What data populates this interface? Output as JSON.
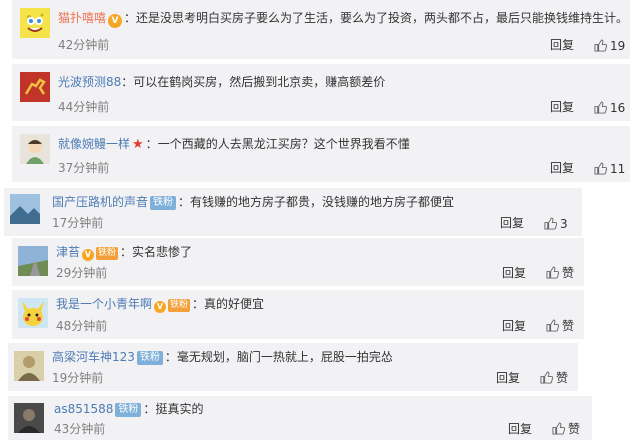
{
  "comments": [
    {
      "name": "猫扑嘻嘻",
      "name_style": "orange",
      "has_vip": true,
      "text": "还是没思考明白买房子要么为了生活，要么为了投资，两头都不占，最后只能换钱维持生计。",
      "time": "42分钟前",
      "reply": "回复",
      "likes": "19",
      "avatar_icon": "sponge-avatar-icon"
    },
    {
      "name": "光波预测88",
      "name_style": "blue",
      "text": "可以在鹤岗买房，然后搬到北京卖，赚高额差价",
      "time": "44分钟前",
      "reply": "回复",
      "likes": "16",
      "avatar_icon": "horse-avatar-icon"
    },
    {
      "name": "就像婉鳗一样",
      "name_style": "blue",
      "has_star": true,
      "text": "一个西藏的人去黑龙江买房？这个世界我看不懂",
      "time": "37分钟前",
      "reply": "回复",
      "likes": "11",
      "avatar_icon": "cartoon-avatar-icon"
    },
    {
      "name": "国产压路机的声音",
      "name_style": "blue",
      "badge": "铁粉",
      "text": "有钱赚的地方房子都贵，没钱赚的地方房子都便宜",
      "time": "17分钟前",
      "reply": "回复",
      "likes": "3",
      "avatar_icon": "landscape-avatar-icon"
    },
    {
      "name": "津苔",
      "name_style": "blue",
      "vip_badge": "铁粉",
      "text": "实名悲惨了",
      "time": "29分钟前",
      "reply": "回复",
      "likes": "赞",
      "avatar_icon": "road-avatar-icon"
    },
    {
      "name": "我是一个小青年啊",
      "name_style": "blue",
      "vip_badge": "铁粉",
      "text": "真的好便宜",
      "time": "48分钟前",
      "reply": "回复",
      "likes": "赞",
      "avatar_icon": "pikachu-avatar-icon"
    },
    {
      "name": "高梁河车神123",
      "name_style": "blue",
      "badge": "铁粉",
      "text": "毫无规划，脑门一热就上，屁股一拍完怂",
      "time": "19分钟前",
      "reply": "回复",
      "likes": "赞",
      "avatar_icon": "person-avatar-icon"
    },
    {
      "name": "as851588",
      "name_style": "blue",
      "badge": "铁粉",
      "text": "挺真实的",
      "time": "43分钟前",
      "reply": "回复",
      "likes": "赞",
      "avatar_icon": "dark-avatar-icon"
    }
  ],
  "colors": {
    "background": "#f2f2f5",
    "name_blue": "#4d7bb3",
    "name_orange": "#eb7350",
    "time_gray": "#808080",
    "badge": "#7fb0d9"
  }
}
